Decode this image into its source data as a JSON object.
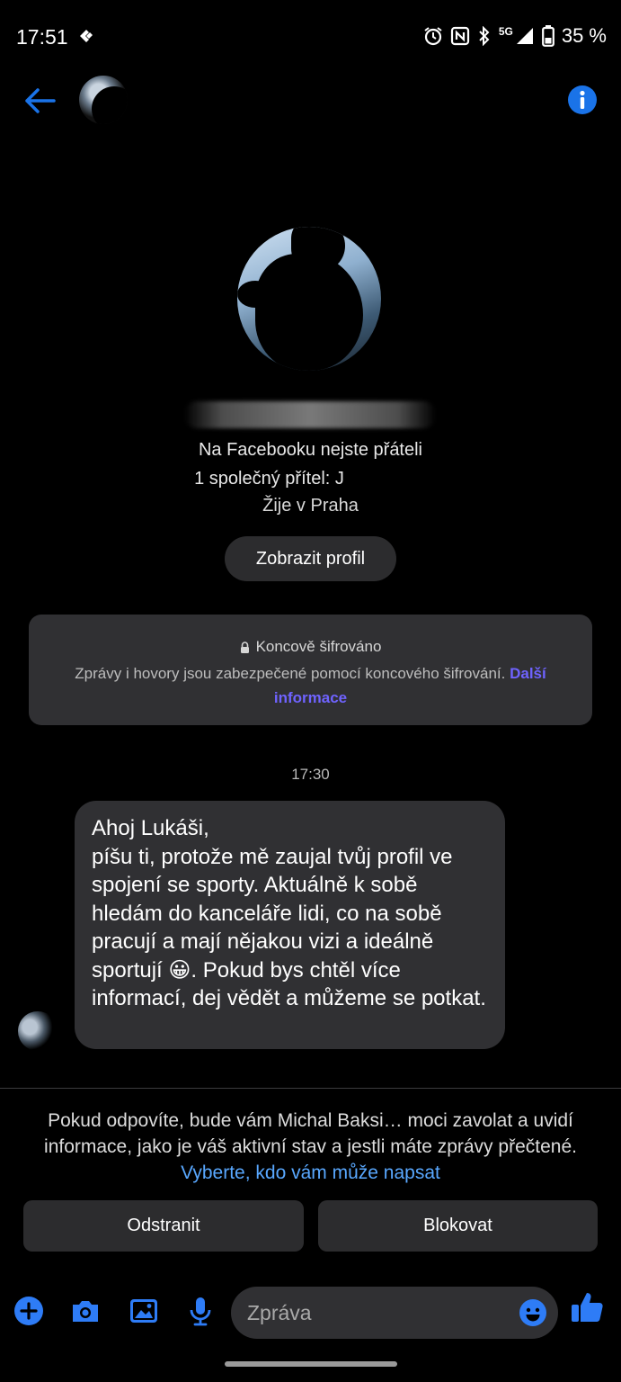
{
  "status_bar": {
    "time": "17:51",
    "network": "5G",
    "battery": "35 %",
    "icons": [
      "alarm-icon",
      "nfc-icon",
      "bluetooth-icon",
      "signal-icon",
      "battery-icon"
    ]
  },
  "header": {
    "back_icon": "arrow-left-icon",
    "info_icon": "info-icon",
    "accent_color": "#1a73e8"
  },
  "profile": {
    "friends_status": "Na Facebooku nejste přáteli",
    "mutual_friends": "1 společný přítel: J",
    "lives_in": "Žije v Praha",
    "view_profile": "Zobrazit profil"
  },
  "encryption": {
    "title": "Koncově šifrováno",
    "body": "Zprávy i hovory jsou zabezpečené pomocí koncového šifrování.",
    "link": "Další informace",
    "link_color": "#6f63ff"
  },
  "conversation": {
    "timestamp": "17:30",
    "message": "Ahoj Lukáši,\npíšu ti, protože mě zaujal tvůj profil ve spojení se sporty. Aktuálně k sobě hledám do kanceláře lidi, co na sobě pracují a mají nějakou vizi a ideálně sportují 😀. Pokud bys chtěl více informací, dej vědět a můžeme se potkat."
  },
  "request_notice": {
    "text": "Pokud odpovíte, bude vám Michal Baksi… moci zavolat a uvidí informace, jako je váš aktivní stav a jestli máte zprávy přečtené.",
    "link": "Vyberte, kdo vám může napsat",
    "link_color": "#59a8ff"
  },
  "actions": {
    "remove": "Odstranit",
    "block": "Blokovat"
  },
  "composer": {
    "placeholder": "Zpráva",
    "icons": [
      "plus-icon",
      "camera-icon",
      "gallery-icon",
      "microphone-icon",
      "emoji-icon",
      "thumbs-up-icon"
    ],
    "accent_color": "#2e7cf6"
  }
}
